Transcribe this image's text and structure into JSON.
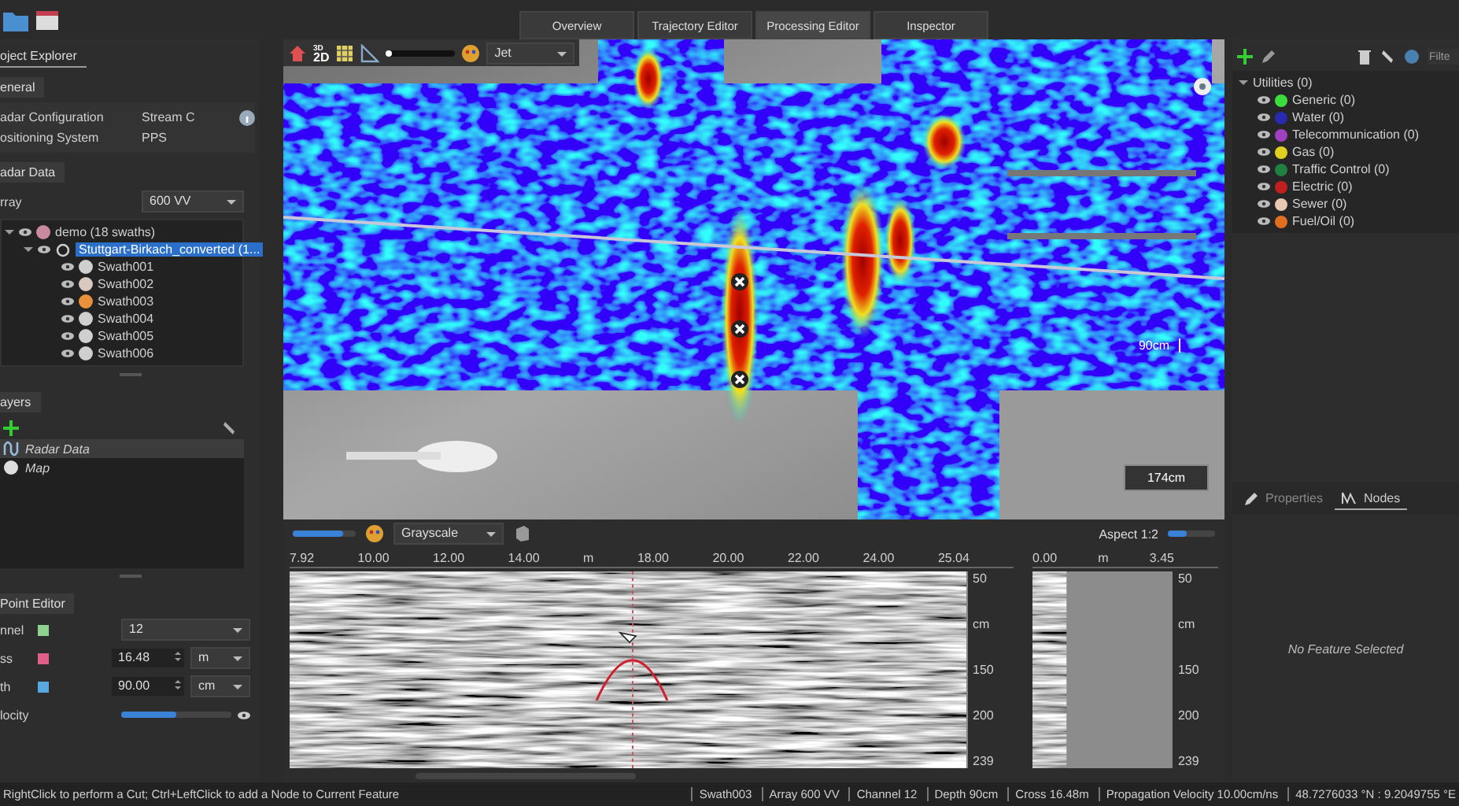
{
  "view_tabs": [
    {
      "label": "Overview",
      "selected": false
    },
    {
      "label": "Trajectory Editor",
      "selected": false
    },
    {
      "label": "Processing Editor",
      "selected": true
    },
    {
      "label": "Inspector",
      "selected": false
    }
  ],
  "project_explorer": {
    "tab": "oject Explorer",
    "general": {
      "title": "eneral",
      "rows": [
        {
          "label": "adar Configuration",
          "value": "Stream C"
        },
        {
          "label": "ositioning System",
          "value": "PPS"
        }
      ]
    },
    "radar_data": {
      "title": "adar Data",
      "array_label": "rray",
      "array_value": "600 VV",
      "tree": [
        {
          "label": "demo (18 swaths)",
          "color": "#c98aa0",
          "expanded": true,
          "selected": false,
          "children": [
            {
              "label": "Stuttgart-Birkach_converted (1...",
              "selected": true,
              "expanded": true,
              "children": [
                {
                  "label": "Swath001",
                  "color": "#cfcfcf",
                  "selected": false
                },
                {
                  "label": "Swath002",
                  "color": "#d8c8c0",
                  "selected": false
                },
                {
                  "label": "Swath003",
                  "color": "#e8903a",
                  "selected": false
                },
                {
                  "label": "Swath004",
                  "color": "#cfcfcf",
                  "selected": false
                },
                {
                  "label": "Swath005",
                  "color": "#cfcfcf",
                  "selected": false
                },
                {
                  "label": "Swath006",
                  "color": "#cfcfcf",
                  "selected": false
                }
              ]
            }
          ]
        }
      ]
    }
  },
  "layers": {
    "title": "ayers",
    "items": [
      {
        "label": "Radar Data",
        "selected": true
      },
      {
        "label": "Map",
        "selected": false
      }
    ]
  },
  "point_editor": {
    "title": "Point Editor",
    "rows": [
      {
        "kind": "dropdown",
        "label": "nnel",
        "color": "#8fd18f",
        "value": "12"
      },
      {
        "kind": "spin",
        "label": "ss",
        "color": "#e0608a",
        "value": "16.48",
        "unit": "m"
      },
      {
        "kind": "spin",
        "label": "th",
        "color": "#5aa8e0",
        "value": "90.00",
        "unit": "cm"
      },
      {
        "kind": "slider",
        "label": "locity",
        "level": 0.5
      }
    ]
  },
  "map": {
    "dimension_toggle": {
      "upper": "3D",
      "lower": "2D"
    },
    "opacity_slider": {
      "level": 0.08
    },
    "colormap": "Jet",
    "depth_label": "90cm",
    "scale_label": "174cm"
  },
  "radargram": {
    "contrast_slider": {
      "level": 0.8
    },
    "colormap": "Grayscale",
    "aspect": "Aspect 1:2",
    "aspect_slider": {
      "level": 0.4
    },
    "x_ticks": [
      "7.92",
      "10.00",
      "12.00",
      "14.00",
      "m",
      "18.00",
      "20.00",
      "22.00",
      "24.00",
      "25.04"
    ],
    "y_ticks": [
      "50",
      "cm",
      "150",
      "200",
      "239"
    ]
  },
  "cross_section": {
    "x_ticks": [
      "0.00",
      "m",
      "3.45"
    ],
    "y_ticks": [
      "50",
      "cm",
      "150",
      "200",
      "239"
    ]
  },
  "features": {
    "filter_placeholder": "Filte",
    "tree": {
      "label": "Utilities (0)",
      "expanded": true,
      "children": [
        {
          "label": "Generic (0)",
          "color": "#3ddc3d"
        },
        {
          "label": "Water (0)",
          "color": "#2a2ab0"
        },
        {
          "label": "Telecommunication (0)",
          "color": "#a040c0"
        },
        {
          "label": "Gas (0)",
          "color": "#e0d020"
        },
        {
          "label": "Traffic Control (0)",
          "color": "#208040"
        },
        {
          "label": "Electric (0)",
          "color": "#c02020"
        },
        {
          "label": "Sewer (0)",
          "color": "#e8c8b0"
        },
        {
          "label": "Fuel/Oil (0)",
          "color": "#e07020"
        }
      ]
    },
    "tabs": [
      {
        "label": "Properties",
        "selected": false
      },
      {
        "label": "Nodes",
        "selected": true
      }
    ],
    "empty_message": "No Feature Selected"
  },
  "status_bar": {
    "hint": "RightClick to perform a Cut; Ctrl+LeftClick to add a Node to Current Feature",
    "fields": [
      "Swath003",
      "Array 600 VV",
      "Channel 12",
      "Depth 90cm",
      "Cross 16.48m",
      "Propagation Velocity 10.00cm/ns",
      "48.7276033 °N : 9.2049755 °E"
    ]
  }
}
